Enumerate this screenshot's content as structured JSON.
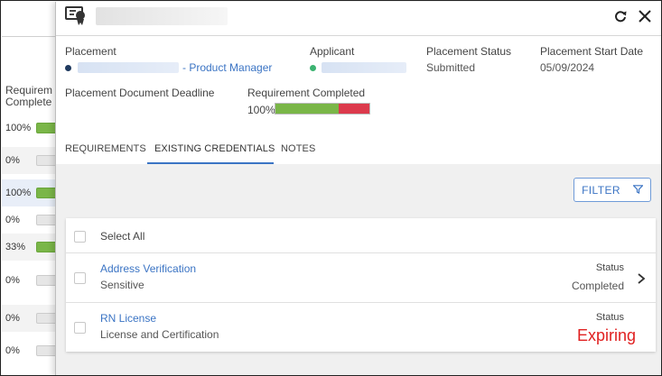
{
  "background_list": {
    "header_lines": [
      "Requirem",
      "Complete"
    ],
    "rows": [
      {
        "pct": "100%",
        "filled": true
      },
      {
        "pct": "0%",
        "filled": false
      },
      {
        "pct": "100%",
        "filled": true
      },
      {
        "pct": "0%",
        "filled": false
      },
      {
        "pct": "33%",
        "filled": true
      },
      {
        "pct": "0%",
        "filled": false
      },
      {
        "pct": "0%",
        "filled": false
      },
      {
        "pct": "0%",
        "filled": false
      }
    ]
  },
  "drawer": {
    "info": {
      "placement_label": "Placement",
      "placement_value": "- Product Manager",
      "applicant_label": "Applicant",
      "status_label": "Placement Status",
      "status_value": "Submitted",
      "start_label": "Placement Start Date",
      "start_value": "05/09/2024",
      "deadline_label": "Placement Document Deadline",
      "req_completed_label": "Requirement Completed",
      "req_completed_value": "100%",
      "req_completed_green_fraction": 0.67
    },
    "tabs": [
      "REQUIREMENTS",
      "EXISTING CREDENTIALS",
      "NOTES"
    ],
    "active_tab": "EXISTING CREDENTIALS",
    "filter_label": "FILTER",
    "select_all_label": "Select All",
    "credentials": [
      {
        "title": "Address Verification",
        "subtitle": "Sensitive",
        "status_label": "Status",
        "status_value": "Completed"
      },
      {
        "title": "RN License",
        "subtitle": "License and Certification",
        "status_label": "Status",
        "status_value": ""
      }
    ],
    "annotation": "Expiring"
  },
  "colors": {
    "accent": "#3b74c4",
    "progress_green": "#7ab648",
    "progress_red": "#dc3a4c",
    "placement_dot": "#1f3a5f",
    "applicant_dot": "#3cb371",
    "annotation_red": "#e02020"
  },
  "icons": [
    "credential-badge-icon",
    "refresh-icon",
    "close-icon",
    "filter-funnel-icon",
    "chevron-right-icon"
  ]
}
